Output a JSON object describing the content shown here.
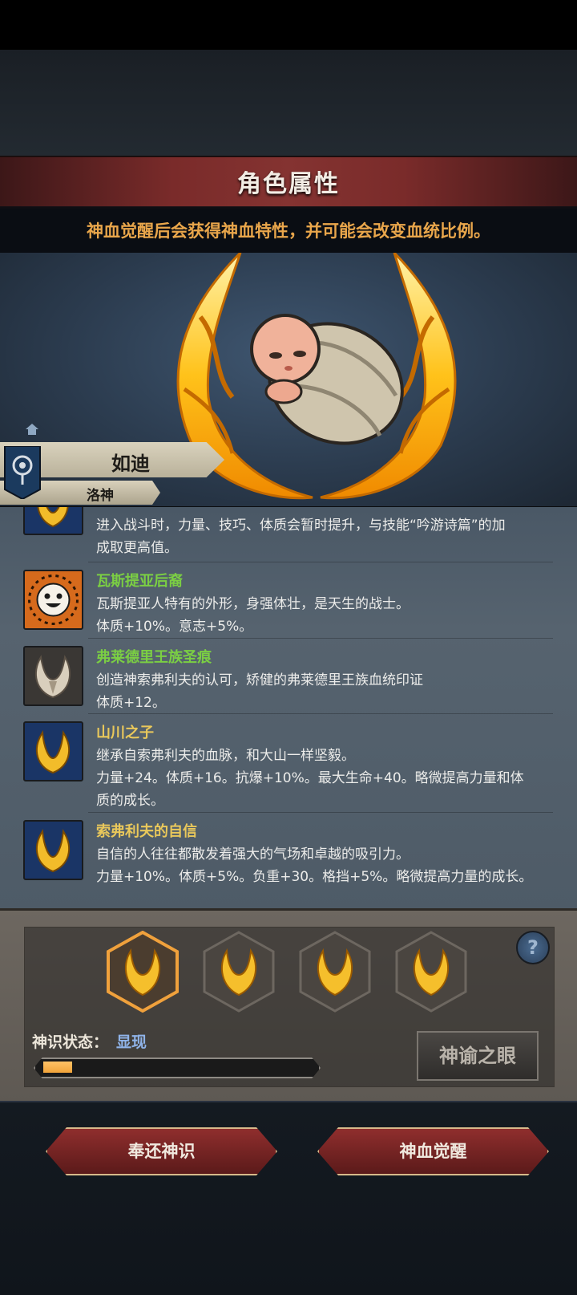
{
  "header": {
    "title": "角色属性",
    "subtitle": "神血觉醒后会获得神血特性，并可能会改变血统比例。"
  },
  "character": {
    "name": "如迪",
    "title": "洛神"
  },
  "traits": [
    {
      "name": "",
      "name_color": "#e9c85b",
      "icon": "divine-flame-blue-icon",
      "lines": [
        "进入战斗时，力量、技巧、体质会暂时提升，与技能“吟游诗篇”的加",
        "成取更高值。"
      ]
    },
    {
      "name": "瓦斯提亚后裔",
      "name_color": "#7bcf43",
      "icon": "smiling-sun-face-icon",
      "lines": [
        "瓦斯提亚人特有的外形，身强体壮，是天生的战士。",
        "体质+10%。意志+5%。"
      ]
    },
    {
      "name": "弗莱德里王族圣痕",
      "name_color": "#7bcf43",
      "icon": "bone-crest-icon",
      "lines": [
        "创造神索弗利夫的认可，矫健的弗莱德里王族血统印证",
        "体质+12。"
      ]
    },
    {
      "name": "山川之子",
      "name_color": "#e9c85b",
      "icon": "divine-flame-blue-icon",
      "lines": [
        "继承自索弗利夫的血脉，和大山一样坚毅。",
        "力量+24。体质+16。抗爆+10%。最大生命+40。略微提高力量和体",
        "质的成长。"
      ]
    },
    {
      "name": "索弗利夫的自信",
      "name_color": "#e9c85b",
      "icon": "divine-flame-blue-icon",
      "lines": [
        "自信的人往往都散发着强大的气场和卓越的吸引力。",
        "力量+10%。体质+5%。负重+30。格挡+5%。略微提高力量的成长。"
      ]
    }
  ],
  "divine_slots": [
    "divine-flame-slot-1",
    "divine-flame-slot-2",
    "divine-flame-slot-3",
    "divine-flame-slot-4"
  ],
  "status": {
    "label": "神识状态：",
    "value": "显现",
    "progress": 0.11
  },
  "buttons": {
    "oracle_eye": "神谕之眼",
    "return_divine": "奉还神识",
    "awaken": "神血觉醒",
    "help": "?"
  }
}
